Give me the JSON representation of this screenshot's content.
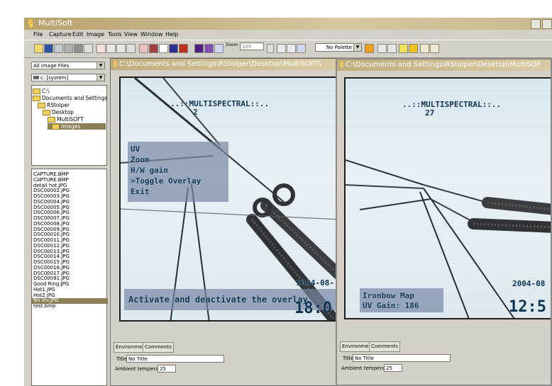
{
  "app": {
    "title": "MultiSoft"
  },
  "menu": [
    "File",
    "Capture",
    "Edit",
    "Image",
    "Tools",
    "View",
    "Window",
    "Help"
  ],
  "toolbar": {
    "zoom_label": "Zoom",
    "zoom_value": "100",
    "palette_value": "No Palette"
  },
  "left_panel": {
    "file_filter": "All image Files",
    "drive": "c: [system]",
    "tree": [
      "C:\\",
      "Documents and Settings",
      "RStolper",
      "Desktop",
      "MultiSOFT",
      "Images"
    ],
    "files": [
      "CAPTURE.BMP",
      "CAPTURE.BMP",
      "detail hot.JPG",
      "DSC00002.JPG",
      "DSC00003.JPG",
      "DSC00004.JPG",
      "DSC00005.JPG",
      "DSC00006.JPG",
      "DSC00007.JPG",
      "DSC00008.JPG",
      "DSC00009.JPG",
      "DSC00010.JPG",
      "DSC00011.JPG",
      "DSC00012.JPG",
      "DSC00013.JPG",
      "DSC00014.JPG",
      "DSC00015.JPG",
      "DSC00016.JPG",
      "DSC00017.JPG",
      "DSC00091.JPG",
      "Good Ring.JPG",
      "Hot1.JPG",
      "Hot2.JPG",
      "No lev.JPG",
      "test.bmp"
    ],
    "selected_file_index": 23
  },
  "windows": [
    {
      "title": "C:\\Documents and Settings\\RStolper\\Desktop\\MultiSOFT\\",
      "osd_header": "..::MULTISPECTRAL::..",
      "osd_number": "2",
      "osd_menu": [
        "UV",
        "Zoom",
        "H/W gain",
        ">Toggle Overlay",
        "Exit"
      ],
      "osd_bottom": "Activate and deactivate the overlay",
      "osd_date": "2004-08-",
      "osd_time": "18:0",
      "tabs": [
        "Environment",
        "Comments"
      ],
      "title_label": "Title",
      "title_value": "No Title",
      "ambient_label": "Ambient temperature",
      "ambient_value": "25"
    },
    {
      "title": "C:\\Documents and Settings\\RStolper\\Desktop\\MultiSOF",
      "osd_header": "..::MULTISPECTRAL::..",
      "osd_number": "27",
      "osd_status_1": "Ironbow Map",
      "osd_status_2": "UV Gain: 186",
      "osd_date": "2004-08",
      "osd_time": "12:5",
      "tabs": [
        "Environment",
        "Comments"
      ],
      "title_label": "Title",
      "title_value": "No Title",
      "ambient_label": "Ambient temperature",
      "ambient_value": "25"
    }
  ]
}
